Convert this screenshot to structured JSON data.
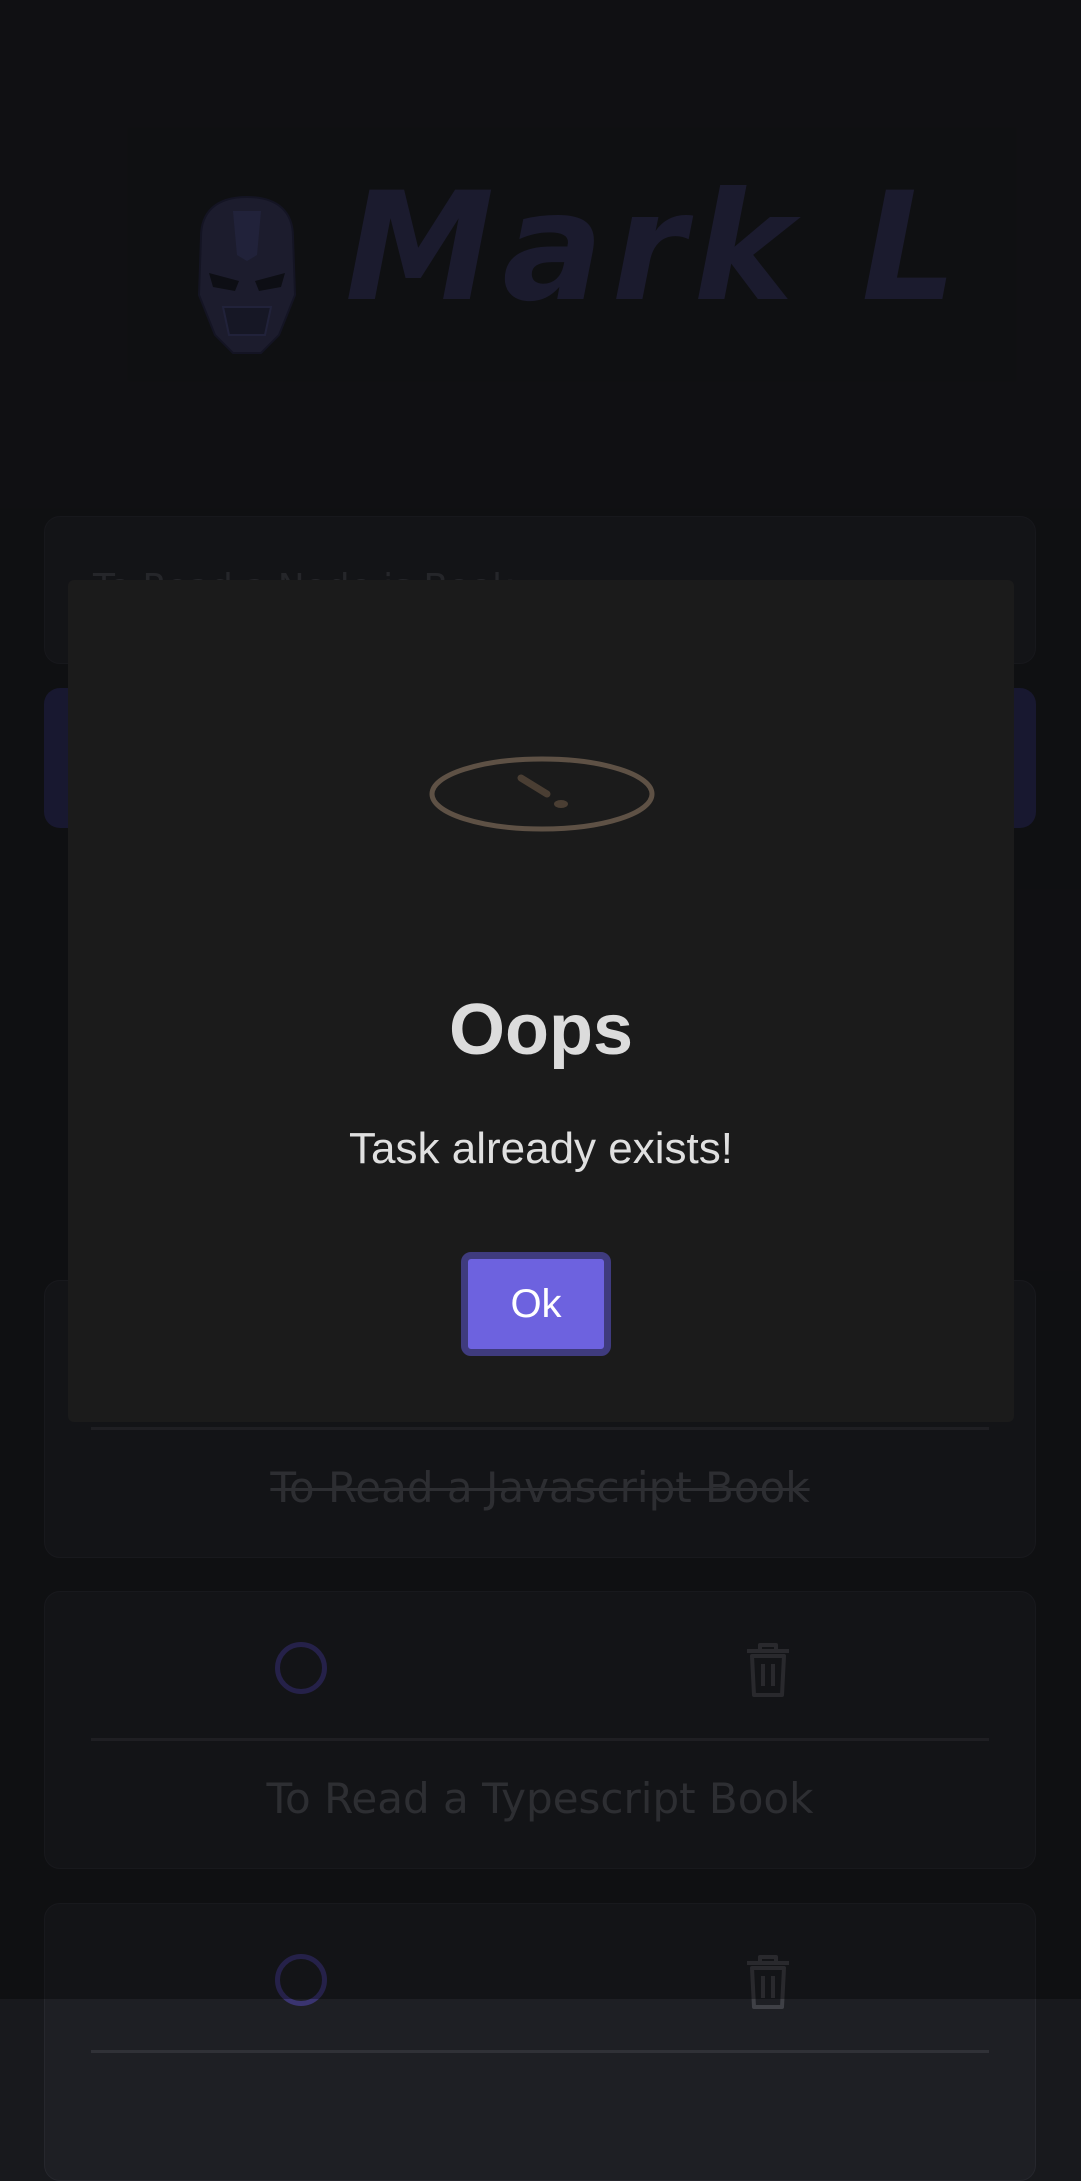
{
  "app": {
    "logo_text": "Mark L"
  },
  "form": {
    "input_value": "To Read a Node.js Book"
  },
  "tasks": [
    {
      "title": "To Read a Javascript Book",
      "completed": true
    },
    {
      "title": "To Read a Typescript Book",
      "completed": false
    },
    {
      "title": "",
      "completed": false
    }
  ],
  "modal": {
    "title": "Oops",
    "message": "Task already exists!",
    "ok_label": "Ok",
    "icon": "warning-icon"
  },
  "colors": {
    "background": "#18191d",
    "accent": "#6d62df",
    "modal_bg": "#1b1b1b",
    "warning": "#5e5145"
  }
}
